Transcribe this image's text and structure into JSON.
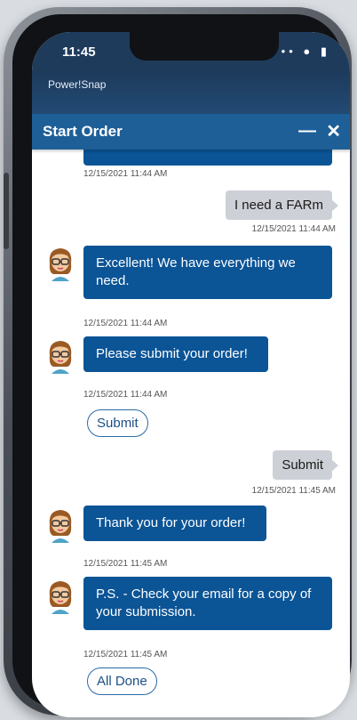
{
  "status": {
    "time": "11:45",
    "icons": "•• ● ▮"
  },
  "app": {
    "title": "Power!Snap"
  },
  "panel": {
    "title": "Start Order",
    "minimize_label": "—",
    "close_label": "✕"
  },
  "messages": [
    {
      "ts": "12/15/2021 11:44 AM"
    },
    {
      "text": "I need a FARm",
      "ts": "12/15/2021 11:44 AM"
    },
    {
      "text": "Excellent!  We have everything we need.",
      "ts": "12/15/2021 11:44 AM"
    },
    {
      "text": "Please submit your order!",
      "ts": "12/15/2021 11:44 AM"
    },
    {
      "button": "Submit"
    },
    {
      "text": "Submit",
      "ts": "12/15/2021 11:45 AM"
    },
    {
      "text": "Thank you for your order!",
      "ts": "12/15/2021 11:45 AM"
    },
    {
      "text": "P.S. - Check your email for a copy of your submission.",
      "ts": "12/15/2021 11:45 AM"
    },
    {
      "button": "All Done"
    }
  ],
  "colors": {
    "bot_bubble": "#0b5496",
    "user_bubble": "#cdd0d6",
    "header": "#1f5f98"
  }
}
